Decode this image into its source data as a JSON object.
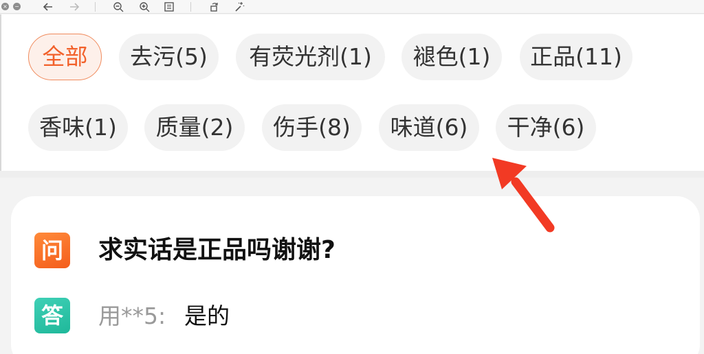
{
  "toolbar": {
    "icons": [
      "close-icon",
      "minimize-icon",
      "back-arrow-icon",
      "forward-arrow-icon",
      "zoom-out-icon",
      "zoom-in-icon",
      "fit-window-icon",
      "rotate-icon",
      "magic-wand-icon"
    ],
    "close_glyph": "×",
    "minimize_glyph": "−"
  },
  "filters": {
    "chips": [
      {
        "label": "全部",
        "active": true
      },
      {
        "label": "去污(5)",
        "active": false
      },
      {
        "label": "有荧光剂(1)",
        "active": false
      },
      {
        "label": "褪色(1)",
        "active": false
      },
      {
        "label": "正品(11)",
        "active": false
      },
      {
        "label": "香味(1)",
        "active": false
      },
      {
        "label": "质量(2)",
        "active": false
      },
      {
        "label": "伤手(8)",
        "active": false
      },
      {
        "label": "味道(6)",
        "active": false
      },
      {
        "label": "干净(6)",
        "active": false
      }
    ]
  },
  "qa": {
    "question_badge": "问",
    "question": "求实话是正品吗谢谢?",
    "answer_badge": "答",
    "answer_user": "用**5:",
    "answer_text": "是的"
  },
  "colors": {
    "accent": "#f2612b",
    "annotation_arrow": "#f23a24",
    "question_badge": "#f45d1c",
    "answer_badge": "#1fb89a"
  }
}
